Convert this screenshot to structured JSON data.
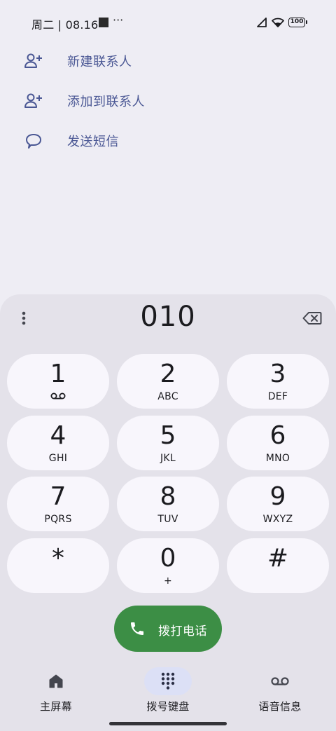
{
  "status_bar": {
    "date_time": "周二 | 08.16",
    "more": "···",
    "battery": "100"
  },
  "actions": [
    {
      "label": "新建联系人",
      "icon": "add-person-icon"
    },
    {
      "label": "添加到联系人",
      "icon": "add-person-icon"
    },
    {
      "label": "发送短信",
      "icon": "message-bubble-icon"
    }
  ],
  "dialer": {
    "number": "010",
    "keys": [
      {
        "digit": "1",
        "letters": "",
        "sub_icon": "voicemail-icon"
      },
      {
        "digit": "2",
        "letters": "ABC"
      },
      {
        "digit": "3",
        "letters": "DEF"
      },
      {
        "digit": "4",
        "letters": "GHI"
      },
      {
        "digit": "5",
        "letters": "JKL"
      },
      {
        "digit": "6",
        "letters": "MNO"
      },
      {
        "digit": "7",
        "letters": "PQRS"
      },
      {
        "digit": "8",
        "letters": "TUV"
      },
      {
        "digit": "9",
        "letters": "WXYZ"
      },
      {
        "digit": "*",
        "letters": ""
      },
      {
        "digit": "0",
        "letters": "+"
      },
      {
        "digit": "#",
        "letters": ""
      }
    ],
    "call_label": "拨打电话"
  },
  "bottom_nav": [
    {
      "label": "主屏幕",
      "icon": "home-icon",
      "active": false
    },
    {
      "label": "拨号键盘",
      "icon": "dialpad-icon",
      "active": true
    },
    {
      "label": "语音信息",
      "icon": "voicemail-icon",
      "active": false
    }
  ],
  "colors": {
    "background": "#eeedf4",
    "sheet": "#e4e2ea",
    "key": "#f8f6fc",
    "accent_text": "#4a5794",
    "call_green": "#3c8e45",
    "nav_active": "#dce0f6"
  }
}
